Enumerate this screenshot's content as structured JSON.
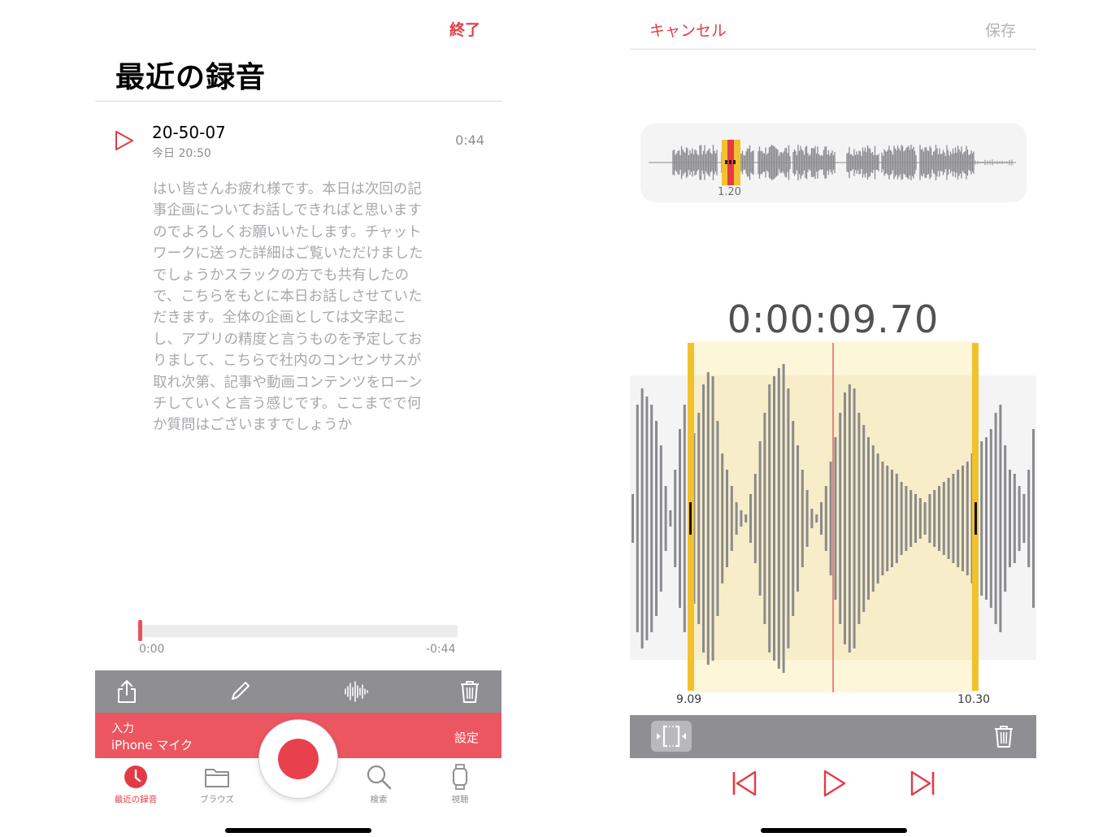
{
  "left": {
    "done_label": "終了",
    "title": "最近の録音",
    "recording": {
      "name": "20-50-07",
      "date": "今日 20:50",
      "duration": "0:44"
    },
    "transcript_lines": [
      "はい皆さんお疲れ様です。本日は次回の記",
      "事企画についてお話しできればと思います",
      "のでよろしくお願いいたします。チャット",
      "ワークに送った詳細はご覧いただけました",
      "でしょうかスラックの方でも共有したの",
      "で、こちらをもとに本日お話しさせていた",
      "だきます。全体の企画としては文字起こ",
      "し、アプリの精度と言うものを予定してお",
      "りまして、こちらで社内のコンセンサスが",
      "取れ次第、記事や動画コンテンツをローン",
      "チしていくと言う感じです。ここまでで何",
      "か質問はございますでしょうか"
    ],
    "playback": {
      "elapsed": "0:00",
      "remaining": "-0:44",
      "progress_fraction": 0.0
    },
    "toolbar_icons": [
      "share-icon",
      "pencil-icon",
      "waveform-icon",
      "trash-icon"
    ],
    "input": {
      "label": "入力",
      "value": "iPhone マイク",
      "settings_label": "設定"
    },
    "tabs": [
      {
        "label": "最近の録音",
        "icon": "clock-icon",
        "active": true
      },
      {
        "label": "ブラウズ",
        "icon": "folder-icon",
        "active": false
      },
      {
        "label": "検索",
        "icon": "search-icon",
        "active": false
      },
      {
        "label": "視聴",
        "icon": "watch-icon",
        "active": false
      }
    ]
  },
  "right": {
    "cancel_label": "キャンセル",
    "save_label": "保存",
    "overview_time": "1.20",
    "timecode": "0:00:09.70",
    "selection": {
      "start": "9.09",
      "end": "10.30"
    },
    "controls": [
      "skip-back-icon",
      "play-icon",
      "skip-forward-icon"
    ]
  },
  "colors": {
    "accent_red": "#e33b45",
    "record_red": "#e8414d",
    "input_bar": "#ec5660",
    "toolbar_gray": "#8e8e93",
    "selection_yellow": "#f2c12e",
    "selection_fill": "#fdf6d8",
    "waveform_gray": "#8a8a8e"
  }
}
